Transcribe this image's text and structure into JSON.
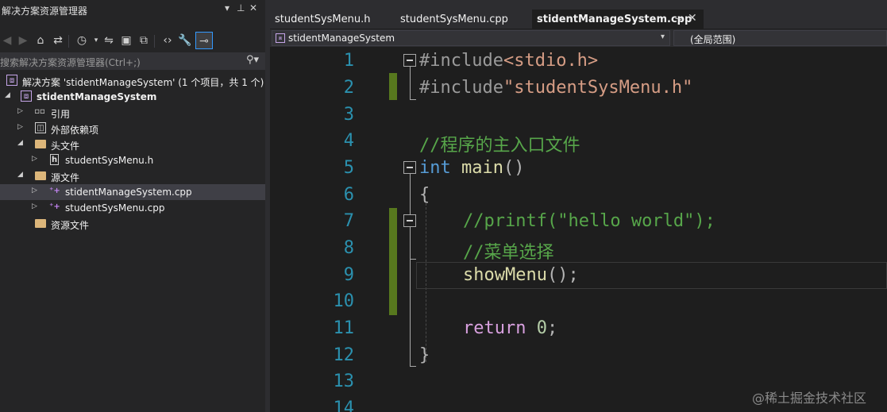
{
  "explorer": {
    "title": "解决方案资源管理器",
    "search_placeholder": "搜索解决方案资源管理器(Ctrl+;)",
    "solution_label": "解决方案 'stidentManageSystem' (1 个项目，共 1 个)",
    "project_label": "stidentManageSystem",
    "items": [
      {
        "label": "引用"
      },
      {
        "label": "外部依赖项"
      },
      {
        "label": "头文件"
      },
      {
        "label": "studentSysMenu.h"
      },
      {
        "label": "源文件"
      },
      {
        "label": "stidentManageSystem.cpp"
      },
      {
        "label": "studentSysMenu.cpp"
      },
      {
        "label": "资源文件"
      }
    ]
  },
  "editor": {
    "tabs": [
      {
        "label": "studentSysMenu.h"
      },
      {
        "label": "studentSysMenu.cpp"
      },
      {
        "label": "stidentManageSystem.cpp"
      }
    ],
    "project_combo": "stidentManageSystem",
    "scope_combo": "(全局范围)",
    "line_numbers": [
      "1",
      "2",
      "3",
      "4",
      "5",
      "6",
      "7",
      "8",
      "9",
      "10",
      "11",
      "12",
      "13",
      "14"
    ],
    "code": {
      "l1a": "#include",
      "l1b": "<stdio.h>",
      "l2a": "#include",
      "l2b": "\"studentSysMenu.h\"",
      "l4": "//程序的主入口文件",
      "l5a": "int",
      "l5b": " main",
      "l5c": "()",
      "l6": "{",
      "l7": "//printf(\"hello world\");",
      "l8": "//菜单选择",
      "l9a": "showMenu",
      "l9b": "();",
      "l11a": "return",
      "l11b": "0",
      "l11c": ";",
      "l12": "}"
    }
  },
  "watermark": "@稀土掘金技术社区",
  "colors": {
    "background": "#1e1e1e",
    "panel": "#252526",
    "line_number": "#2b91af",
    "keyword": "#569cd6",
    "comment": "#57a64a",
    "change_bar": "#57781e"
  }
}
